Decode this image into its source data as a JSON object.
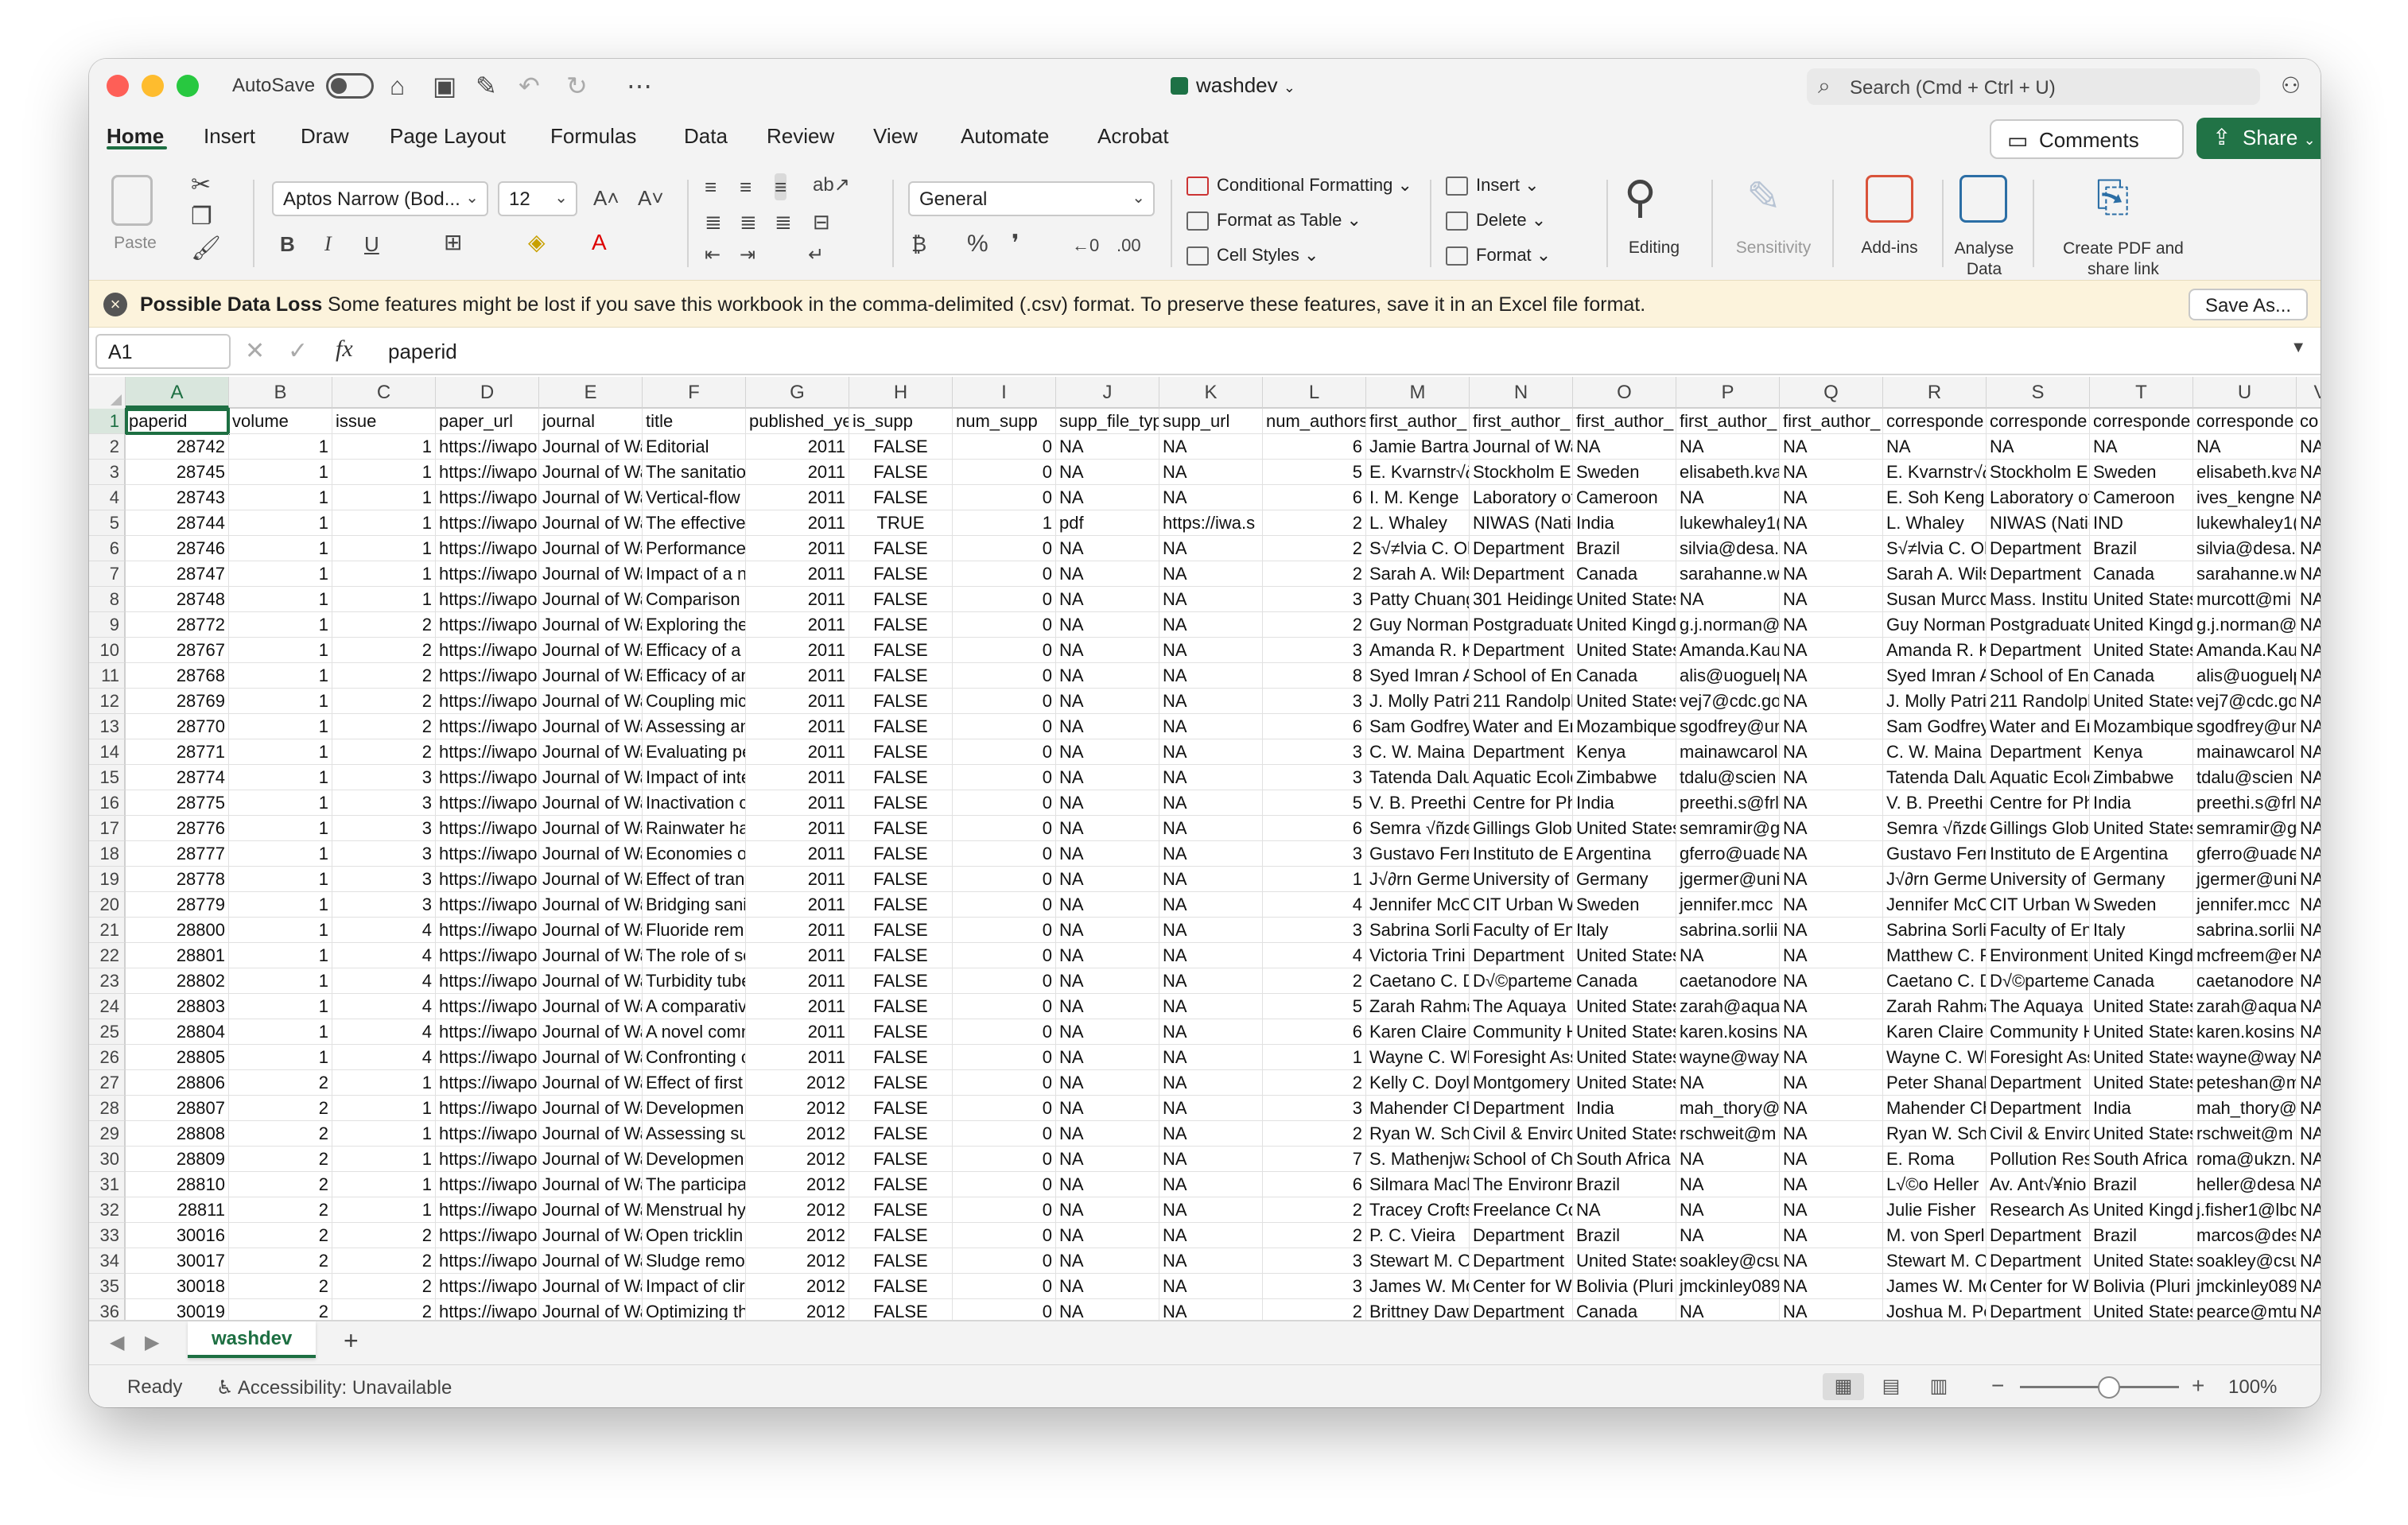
{
  "window": {
    "autosave_label": "AutoSave",
    "doc_title": "washdev",
    "search_placeholder": "Search (Cmd + Ctrl + U)"
  },
  "tabs": [
    "Home",
    "Insert",
    "Draw",
    "Page Layout",
    "Formulas",
    "Data",
    "Review",
    "View",
    "Automate",
    "Acrobat"
  ],
  "actions": {
    "comments": "Comments",
    "share": "Share"
  },
  "ribbon": {
    "paste": "Paste",
    "font_name": "Aptos Narrow (Bod...",
    "font_size": "12",
    "number_format": "General",
    "conditional_formatting": "Conditional Formatting",
    "format_as_table": "Format as Table",
    "cell_styles": "Cell Styles",
    "insert": "Insert",
    "delete": "Delete",
    "format": "Format",
    "editing": "Editing",
    "sensitivity": "Sensitivity",
    "addins": "Add-ins",
    "analyse_data": "Analyse Data",
    "create_pdf": "Create PDF and share link"
  },
  "message_bar": {
    "title": "Possible Data Loss",
    "text": "Some features might be lost if you save this workbook in the comma-delimited (.csv) format. To preserve these features, save it in an Excel file format.",
    "button": "Save As..."
  },
  "formula_bar": {
    "name_box": "A1",
    "fx": "fx",
    "value": "paperid"
  },
  "columns": [
    "A",
    "B",
    "C",
    "D",
    "E",
    "F",
    "G",
    "H",
    "I",
    "J",
    "K",
    "L",
    "M",
    "N",
    "O",
    "P",
    "Q",
    "R",
    "S",
    "T",
    "U",
    "V"
  ],
  "header_row": [
    "paperid",
    "volume",
    "issue",
    "paper_url",
    "journal",
    "title",
    "published_ye",
    "is_supp",
    "num_supp",
    "supp_file_typ",
    "supp_url",
    "num_authors",
    "first_author_",
    "first_author_",
    "first_author_",
    "first_author_",
    "first_author_",
    "corresponde",
    "corresponde",
    "corresponde",
    "corresponde",
    "co"
  ],
  "rows": [
    [
      "28742",
      "1",
      "1",
      "https://iwapo",
      "Journal of Wa",
      "Editorial",
      "2011",
      "FALSE",
      "0",
      "NA",
      "NA",
      "6",
      "Jamie Bartra",
      "Journal of Wa",
      "NA",
      "NA",
      "NA",
      "NA",
      "NA",
      "NA",
      "NA",
      "NA"
    ],
    [
      "28745",
      "1",
      "1",
      "https://iwapo",
      "Journal of Wa",
      "The sanitatio",
      "2011",
      "FALSE",
      "0",
      "NA",
      "NA",
      "5",
      "E. Kvarnstr√∂",
      "Stockholm Er",
      "Sweden",
      "elisabeth.kva",
      "NA",
      "E. Kvarnstr√∂",
      "Stockholm Er",
      "Sweden",
      "elisabeth.kva",
      "NA"
    ],
    [
      "28743",
      "1",
      "1",
      "https://iwapo",
      "Journal of Wa",
      "Vertical-flow",
      "2011",
      "FALSE",
      "0",
      "NA",
      "NA",
      "6",
      "I. M. Kenge",
      "Laboratory of",
      "Cameroon",
      "NA",
      "NA",
      "E. Soh Kengn",
      "Laboratory of",
      "Cameroon",
      "ives_kengne@",
      "NA"
    ],
    [
      "28744",
      "1",
      "1",
      "https://iwapo",
      "Journal of Wa",
      "The effective",
      "2011",
      "TRUE",
      "1",
      "pdf",
      "https://iwa.s",
      "2",
      "L. Whaley",
      "NIWAS (Natio",
      "India",
      "lukewhaley1(",
      "NA",
      "L. Whaley",
      "NIWAS (Natio",
      "IND",
      "lukewhaley1(",
      "NA"
    ],
    [
      "28746",
      "1",
      "1",
      "https://iwapo",
      "Journal of Wa",
      "Performance",
      "2011",
      "FALSE",
      "0",
      "NA",
      "NA",
      "2",
      "S√≠lvia C. Ol",
      "Department",
      "Brazil",
      "silvia@desa.",
      "NA",
      "S√≠lvia C. Ol",
      "Department",
      "Brazil",
      "silvia@desa.",
      "NA"
    ],
    [
      "28747",
      "1",
      "1",
      "https://iwapo",
      "Journal of Wa",
      "Impact of a n",
      "2011",
      "FALSE",
      "0",
      "NA",
      "NA",
      "2",
      "Sarah A. Wils",
      "Department",
      "Canada",
      "sarahanne.w",
      "NA",
      "Sarah A. Wils",
      "Department",
      "Canada",
      "sarahanne.w",
      "NA"
    ],
    [
      "28748",
      "1",
      "1",
      "https://iwapo",
      "Journal of Wa",
      "Comparison",
      "2011",
      "FALSE",
      "0",
      "NA",
      "NA",
      "3",
      "Patty Chuang",
      "301 Heidinge",
      "United States",
      "NA",
      "NA",
      "Susan Murco",
      "Mass. Institu",
      "United States",
      "murcott@mi",
      "NA"
    ],
    [
      "28772",
      "1",
      "2",
      "https://iwapo",
      "Journal of Wa",
      "Exploring the",
      "2011",
      "FALSE",
      "0",
      "NA",
      "NA",
      "2",
      "Guy Norman",
      "Postgraduate",
      "United Kingd",
      "g.j.norman@",
      "NA",
      "Guy Norman",
      "Postgraduate",
      "United Kingd",
      "g.j.norman@",
      "NA"
    ],
    [
      "28767",
      "1",
      "2",
      "https://iwapo",
      "Journal of Wa",
      "Efficacy of a c",
      "2011",
      "FALSE",
      "0",
      "NA",
      "NA",
      "3",
      "Amanda R. Ka",
      "Department",
      "United States",
      "Amanda.Kau",
      "NA",
      "Amanda R. Ka",
      "Department",
      "United States",
      "Amanda.Kau",
      "NA"
    ],
    [
      "28768",
      "1",
      "2",
      "https://iwapo",
      "Journal of Wa",
      "Efficacy of an",
      "2011",
      "FALSE",
      "0",
      "NA",
      "NA",
      "8",
      "Syed Imran A",
      "School of Eng",
      "Canada",
      "alis@uoguelp",
      "NA",
      "Syed Imran A",
      "School of Eng",
      "Canada",
      "alis@uoguelp",
      "NA"
    ],
    [
      "28769",
      "1",
      "2",
      "https://iwapo",
      "Journal of Wa",
      "Coupling mic",
      "2011",
      "FALSE",
      "0",
      "NA",
      "NA",
      "3",
      "J. Molly Patric",
      "211 Randolpl",
      "United States",
      "vej7@cdc.go",
      "NA",
      "J. Molly Patric",
      "211 Randolpl",
      "United States",
      "vej7@cdc.go",
      "NA"
    ],
    [
      "28770",
      "1",
      "2",
      "https://iwapo",
      "Journal of Wa",
      "Assessing anc",
      "2011",
      "FALSE",
      "0",
      "NA",
      "NA",
      "6",
      "Sam Godfrey",
      "Water and Er",
      "Mozambique",
      "sgodfrey@un",
      "NA",
      "Sam Godfrey",
      "Water and Er",
      "Mozambique",
      "sgodfrey@un",
      "NA"
    ],
    [
      "28771",
      "1",
      "2",
      "https://iwapo",
      "Journal of Wa",
      "Evaluating pe",
      "2011",
      "FALSE",
      "0",
      "NA",
      "NA",
      "3",
      "C. W. Maina",
      "Department",
      "Kenya",
      "mainawcarol",
      "NA",
      "C. W. Maina",
      "Department",
      "Kenya",
      "mainawcarol",
      "NA"
    ],
    [
      "28774",
      "1",
      "3",
      "https://iwapo",
      "Journal of Wa",
      "Impact of inte",
      "2011",
      "FALSE",
      "0",
      "NA",
      "NA",
      "3",
      "Tatenda Dalu",
      "Aquatic Ecolo",
      "Zimbabwe",
      "tdalu@scien",
      "NA",
      "Tatenda Dalu",
      "Aquatic Ecolo",
      "Zimbabwe",
      "tdalu@scien",
      "NA"
    ],
    [
      "28775",
      "1",
      "3",
      "https://iwapo",
      "Journal of Wa",
      "Inactivation c",
      "2011",
      "FALSE",
      "0",
      "NA",
      "NA",
      "5",
      "V. B. Preethi S",
      "Centre for Ph",
      "India",
      "preethi.s@frl",
      "NA",
      "V. B. Preethi S",
      "Centre for Ph",
      "India",
      "preethi.s@frl",
      "NA"
    ],
    [
      "28776",
      "1",
      "3",
      "https://iwapo",
      "Journal of Wa",
      "Rainwater ha",
      "2011",
      "FALSE",
      "0",
      "NA",
      "NA",
      "6",
      "Semra √ñzde",
      "Gillings Glob",
      "United States",
      "semramir@g",
      "NA",
      "Semra √ñzde",
      "Gillings Glob",
      "United States",
      "semramir@g",
      "NA"
    ],
    [
      "28777",
      "1",
      "3",
      "https://iwapo",
      "Journal of Wa",
      "Economies o",
      "2011",
      "FALSE",
      "0",
      "NA",
      "NA",
      "3",
      "Gustavo Ferr",
      "Instituto de E",
      "Argentina",
      "gferro@uade",
      "NA",
      "Gustavo Ferr",
      "Instituto de E",
      "Argentina",
      "gferro@uade",
      "NA"
    ],
    [
      "28778",
      "1",
      "3",
      "https://iwapo",
      "Journal of Wa",
      "Effect of tran",
      "2011",
      "FALSE",
      "0",
      "NA",
      "NA",
      "1",
      "J√∂rn Germe",
      "University of",
      "Germany",
      "jgermer@uni",
      "NA",
      "J√∂rn Germe",
      "University of",
      "Germany",
      "jgermer@uni",
      "NA"
    ],
    [
      "28779",
      "1",
      "3",
      "https://iwapo",
      "Journal of Wa",
      "Bridging sani",
      "2011",
      "FALSE",
      "0",
      "NA",
      "NA",
      "4",
      "Jennifer McC",
      "CIT Urban Wa",
      "Sweden",
      "jennifer.mcc",
      "NA",
      "Jennifer McC",
      "CIT Urban Wa",
      "Sweden",
      "jennifer.mcc",
      "NA"
    ],
    [
      "28800",
      "1",
      "4",
      "https://iwapo",
      "Journal of Wa",
      "Fluoride rem",
      "2011",
      "FALSE",
      "0",
      "NA",
      "NA",
      "3",
      "Sabrina Sorli",
      "Faculty of En",
      "Italy",
      "sabrina.sorlii",
      "NA",
      "Sabrina Sorli",
      "Faculty of En",
      "Italy",
      "sabrina.sorlii",
      "NA"
    ],
    [
      "28801",
      "1",
      "4",
      "https://iwapo",
      "Journal of Wa",
      "The role of so",
      "2011",
      "FALSE",
      "0",
      "NA",
      "NA",
      "4",
      "Victoria Trini",
      "Department",
      "United States",
      "NA",
      "NA",
      "Matthew C. F",
      "Environment",
      "United Kingd",
      "mcfreem@er",
      "NA"
    ],
    [
      "28802",
      "1",
      "4",
      "https://iwapo",
      "Journal of Wa",
      "Turbidity tube",
      "2011",
      "FALSE",
      "0",
      "NA",
      "NA",
      "2",
      "Caetano C. D",
      "D√©parteme",
      "Canada",
      "caetanodore",
      "NA",
      "Caetano C. D",
      "D√©parteme",
      "Canada",
      "caetanodore",
      "NA"
    ],
    [
      "28803",
      "1",
      "4",
      "https://iwapo",
      "Journal of Wa",
      "A comparativ",
      "2011",
      "FALSE",
      "0",
      "NA",
      "NA",
      "5",
      "Zarah Rahma",
      "The Aquaya Ir",
      "United States",
      "zarah@aqua",
      "NA",
      "Zarah Rahma",
      "The Aquaya Ir",
      "United States",
      "zarah@aqua",
      "NA"
    ],
    [
      "28804",
      "1",
      "4",
      "https://iwapo",
      "Journal of Wa",
      "A novel comn",
      "2011",
      "FALSE",
      "0",
      "NA",
      "NA",
      "6",
      "Karen Claire",
      "Community H",
      "United States",
      "karen.kosinsl",
      "NA",
      "Karen Claire",
      "Community H",
      "United States",
      "karen.kosinsl",
      "NA"
    ],
    [
      "28805",
      "1",
      "4",
      "https://iwapo",
      "Journal of Wa",
      "Confronting c",
      "2011",
      "FALSE",
      "0",
      "NA",
      "NA",
      "1",
      "Wayne C. Wh",
      "Foresight Ass",
      "United States",
      "wayne@wayn",
      "NA",
      "Wayne C. Wh",
      "Foresight Ass",
      "United States",
      "wayne@wayn",
      "NA"
    ],
    [
      "28806",
      "2",
      "1",
      "https://iwapo",
      "Journal of Wa",
      "Effect of first",
      "2012",
      "FALSE",
      "0",
      "NA",
      "NA",
      "2",
      "Kelly C. Doyl",
      "Montgomery",
      "United States",
      "NA",
      "NA",
      "Peter Shanah",
      "Department",
      "United States",
      "peteshan@m",
      "NA"
    ],
    [
      "28807",
      "2",
      "1",
      "https://iwapo",
      "Journal of Wa",
      "Developmen",
      "2012",
      "FALSE",
      "0",
      "NA",
      "NA",
      "3",
      "Mahender Ch",
      "Department",
      "India",
      "mah_thory@",
      "NA",
      "Mahender Ch",
      "Department",
      "India",
      "mah_thory@",
      "NA"
    ],
    [
      "28808",
      "2",
      "1",
      "https://iwapo",
      "Journal of Wa",
      "Assessing sus",
      "2012",
      "FALSE",
      "0",
      "NA",
      "NA",
      "2",
      "Ryan W. Schw",
      "Civil & Enviro",
      "United States",
      "rschweit@m",
      "NA",
      "Ryan W. Schw",
      "Civil & Enviro",
      "United States",
      "rschweit@m",
      "NA"
    ],
    [
      "28809",
      "2",
      "1",
      "https://iwapo",
      "Journal of Wa",
      "Developmen",
      "2012",
      "FALSE",
      "0",
      "NA",
      "NA",
      "7",
      "S. Mathenjwa",
      "School of Che",
      "South Africa",
      "NA",
      "NA",
      "E. Roma",
      "Pollution Res",
      "South Africa",
      "roma@ukzn.a",
      "NA"
    ],
    [
      "28810",
      "2",
      "1",
      "https://iwapo",
      "Journal of Wa",
      "The participa",
      "2012",
      "FALSE",
      "0",
      "NA",
      "NA",
      "6",
      "Silmara Mach",
      "The Environm",
      "Brazil",
      "NA",
      "NA",
      "L√©o Heller",
      "Av. Ant√¥nio",
      "Brazil",
      "heller@desa",
      "NA"
    ],
    [
      "28811",
      "2",
      "1",
      "https://iwapo",
      "Journal of Wa",
      "Menstrual hy",
      "2012",
      "FALSE",
      "0",
      "NA",
      "NA",
      "2",
      "Tracey Crofts",
      "Freelance Co",
      "NA",
      "NA",
      "NA",
      "Julie Fisher",
      "Research Ass",
      "United Kingd",
      "j.fisher1@lbc",
      "NA"
    ],
    [
      "30016",
      "2",
      "2",
      "https://iwapo",
      "Journal of Wa",
      "Open tricklin",
      "2012",
      "FALSE",
      "0",
      "NA",
      "NA",
      "2",
      "P. C. Vieira",
      "Department",
      "Brazil",
      "NA",
      "NA",
      "M. von Sperli",
      "Department",
      "Brazil",
      "marcos@des",
      "NA"
    ],
    [
      "30017",
      "2",
      "2",
      "https://iwapo",
      "Journal of Wa",
      "Sludge remov",
      "2012",
      "FALSE",
      "0",
      "NA",
      "NA",
      "3",
      "Stewart M. O",
      "Department",
      "United States",
      "soakley@csu",
      "NA",
      "Stewart M. O",
      "Department",
      "United States",
      "soakley@csu",
      "NA"
    ],
    [
      "30018",
      "2",
      "2",
      "https://iwapo",
      "Journal of Wa",
      "Impact of clir",
      "2012",
      "FALSE",
      "0",
      "NA",
      "NA",
      "3",
      "James W. Mc",
      "Center for W",
      "Bolivia (Pluri",
      "jmckinley089",
      "NA",
      "James W. Mc",
      "Center for W",
      "Bolivia (Pluri",
      "jmckinley089",
      "NA"
    ],
    [
      "30019",
      "2",
      "2",
      "https://iwapo",
      "Journal of Wa",
      "Optimizing th",
      "2012",
      "FALSE",
      "0",
      "NA",
      "NA",
      "2",
      "Brittney Daw",
      "Department",
      "Canada",
      "NA",
      "NA",
      "Joshua M. Pe",
      "Department",
      "United States",
      "pearce@mtu",
      "NA"
    ]
  ],
  "sheet_tab": "washdev",
  "status": {
    "ready": "Ready",
    "accessibility": "Accessibility: Unavailable",
    "zoom": "100%"
  },
  "colors": {
    "excel_green": "#1d6f42",
    "share_green": "#217346",
    "warning_bg": "#fcf3dc"
  }
}
